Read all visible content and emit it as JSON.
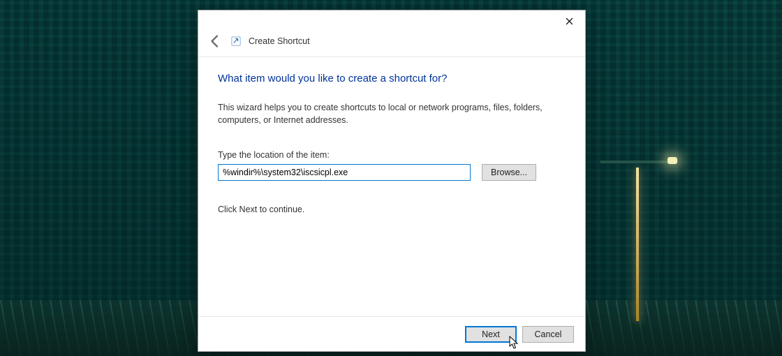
{
  "window": {
    "title": "Create Shortcut"
  },
  "heading": "What item would you like to create a shortcut for?",
  "description": "This wizard helps you to create shortcuts to local or network programs, files, folders, computers, or Internet addresses.",
  "location": {
    "label": "Type the location of the item:",
    "value": "%windir%\\system32\\iscsicpl.exe",
    "browse_label": "Browse..."
  },
  "hint": "Click Next to continue.",
  "footer": {
    "next_label": "Next",
    "cancel_label": "Cancel"
  }
}
